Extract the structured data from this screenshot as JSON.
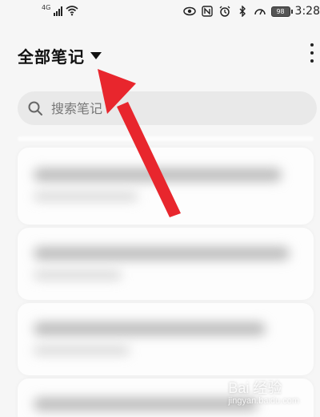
{
  "status_bar": {
    "network": "4G",
    "battery": "98",
    "time": "3:28"
  },
  "header": {
    "title": "全部笔记"
  },
  "search": {
    "placeholder": "搜索笔记"
  },
  "notes": [
    {
      "state": "blurred"
    },
    {
      "state": "blurred"
    },
    {
      "state": "blurred"
    },
    {
      "state": "blurred"
    }
  ],
  "annotation": {
    "arrow_color": "#e8262d"
  },
  "watermark": {
    "text": "Bai 经验",
    "sub": "jingyan.baidu.com"
  },
  "colors": {
    "background": "#f6f6f6",
    "card": "#fdfdfd",
    "search_bg": "#e9e9e9",
    "accent_arrow": "#e8262d"
  }
}
